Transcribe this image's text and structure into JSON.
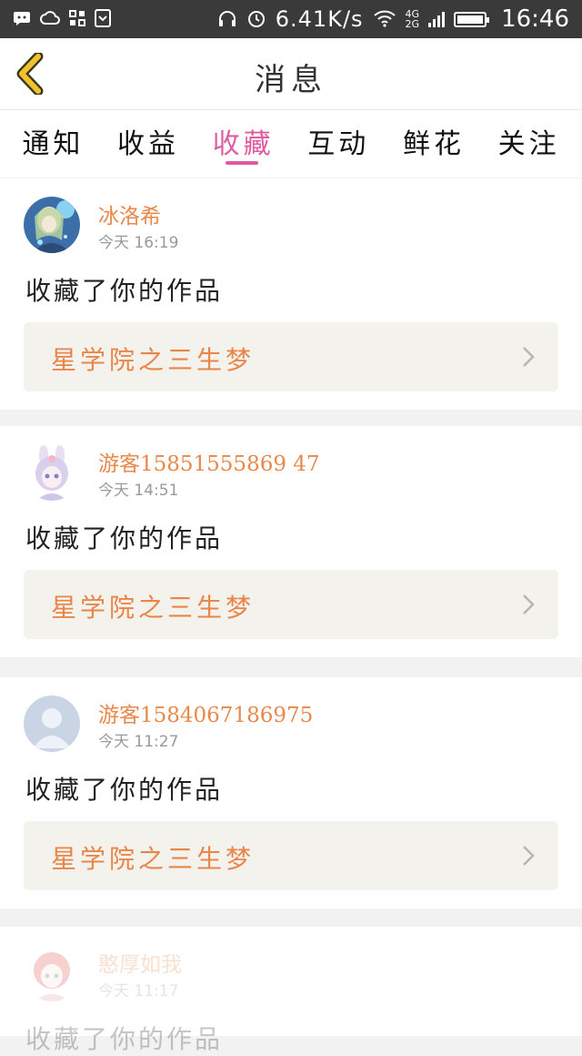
{
  "status_bar": {
    "speed": "6.41K/s",
    "net_top": "4G",
    "net_bottom": "2G",
    "time": "16:46",
    "icons": [
      "notification-icon",
      "cloud-icon",
      "apps-icon",
      "screenshot-icon",
      "headphones-icon",
      "alarm-icon",
      "wifi-icon",
      "signal-icon",
      "battery-icon"
    ]
  },
  "header": {
    "title": "消息",
    "back_icon": "chevron-left-icon",
    "accent_color": "#f2c12e"
  },
  "tabs": [
    {
      "label": "通知",
      "active": false
    },
    {
      "label": "收益",
      "active": false
    },
    {
      "label": "收藏",
      "active": true
    },
    {
      "label": "互动",
      "active": false
    },
    {
      "label": "鲜花",
      "active": false
    },
    {
      "label": "关注",
      "active": false
    }
  ],
  "colors": {
    "active_tab": "#e05ca0",
    "username": "#e8884a",
    "work_title": "#ea8548",
    "work_bg": "#f3f2ec"
  },
  "messages": [
    {
      "username": "冰洛希",
      "time": "今天 16:19",
      "action": "收藏了你的作品",
      "work": "星学院之三生梦",
      "avatar": "anime-girl-blue-avatar"
    },
    {
      "username": "游客15851555869 47",
      "time": "今天 14:51",
      "action": "收藏了你的作品",
      "work": "星学院之三生梦",
      "avatar": "bunny-girl-avatar"
    },
    {
      "username": "游客1584067186975",
      "time": "今天 11:27",
      "action": "收藏了你的作品",
      "work": "星学院之三生梦",
      "avatar": "default-user-avatar"
    },
    {
      "username": "憨厚如我",
      "time": "今天 11:17",
      "action": "收藏了你的作品",
      "work": "",
      "avatar": "red-hair-girl-avatar"
    }
  ]
}
